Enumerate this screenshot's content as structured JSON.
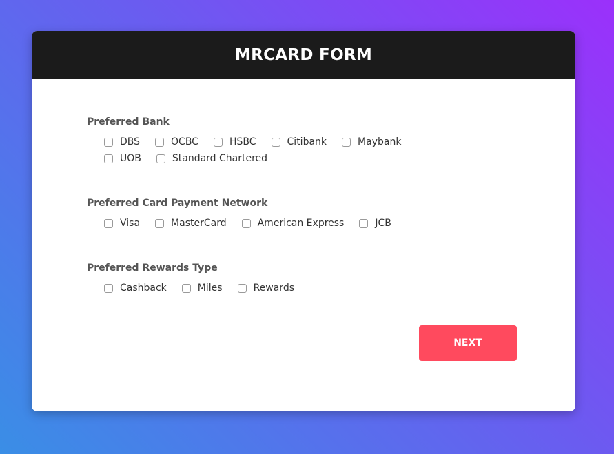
{
  "form": {
    "title": "MRCARD FORM",
    "next_label": "NEXT",
    "accent_color": "#ff4a5e",
    "header_color": "#1b1b1b",
    "groups": [
      {
        "title": "Preferred Bank",
        "options": [
          {
            "label": "DBS",
            "checked": false
          },
          {
            "label": "OCBC",
            "checked": false
          },
          {
            "label": "HSBC",
            "checked": false
          },
          {
            "label": "Citibank",
            "checked": false
          },
          {
            "label": "Maybank",
            "checked": false
          },
          {
            "label": "UOB",
            "checked": false
          },
          {
            "label": "Standard Chartered",
            "checked": false
          }
        ]
      },
      {
        "title": "Preferred Card Payment Network",
        "options": [
          {
            "label": "Visa",
            "checked": false
          },
          {
            "label": "MasterCard",
            "checked": false
          },
          {
            "label": "American Express",
            "checked": false
          },
          {
            "label": "JCB",
            "checked": false
          }
        ]
      },
      {
        "title": "Preferred Rewards Type",
        "options": [
          {
            "label": "Cashback",
            "checked": false
          },
          {
            "label": "Miles",
            "checked": false
          },
          {
            "label": "Rewards",
            "checked": false
          }
        ]
      }
    ]
  }
}
